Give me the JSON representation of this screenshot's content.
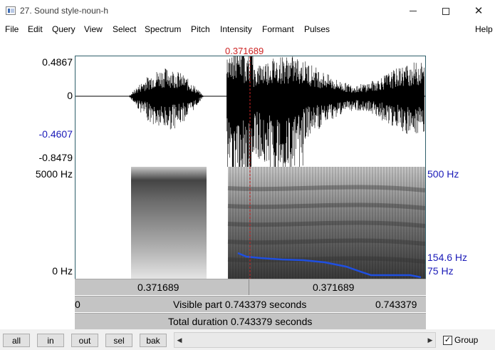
{
  "window": {
    "title": "27. Sound style-noun-h",
    "icon": "praat-sound-icon"
  },
  "menu": {
    "items": [
      "File",
      "Edit",
      "Query",
      "View",
      "Select",
      "Spectrum",
      "Pitch",
      "Intensity",
      "Formant",
      "Pulses"
    ],
    "help": "Help"
  },
  "cursor": {
    "time_label": "0.371689",
    "time_seconds": 0.371689,
    "color": "#cc2222"
  },
  "waveform": {
    "y_max_label": "0.4867",
    "y_zero_label": "0",
    "y_cursor_label": "-0.4607",
    "y_min_label": "-0.8479"
  },
  "spectrogram": {
    "freq_max_label": "5000 Hz",
    "freq_min_label": "0 Hz",
    "pitch_max_label": "500 Hz",
    "pitch_value_label": "154.6 Hz",
    "pitch_min_label": "75 Hz",
    "pitch_color": "#1f4fe0"
  },
  "bars": {
    "left_time": "0.371689",
    "right_time": "0.371689",
    "visible_start": "0",
    "visible_label": "Visible part 0.743379 seconds",
    "visible_end": "0.743379",
    "total_label": "Total duration 0.743379 seconds"
  },
  "toolbar": {
    "buttons": [
      "all",
      "in",
      "out",
      "sel",
      "bak"
    ],
    "group_label": "Group",
    "group_checked": true
  }
}
